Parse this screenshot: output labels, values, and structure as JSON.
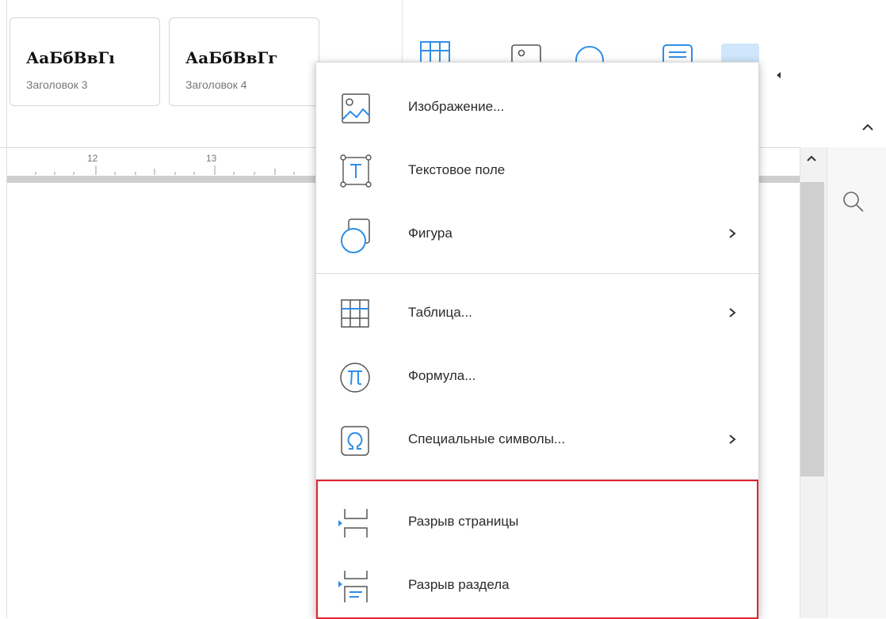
{
  "toolbar": {
    "styles": [
      {
        "preview": "АаБбВвГı",
        "name": "Заголовок 3"
      },
      {
        "preview": "АаБбВвГг",
        "name": "Заголовок 4"
      }
    ]
  },
  "ruler": {
    "ticks": [
      "12",
      "13"
    ]
  },
  "menu": {
    "items": [
      {
        "label": "Изображение...",
        "icon": "image-icon",
        "submenu": false
      },
      {
        "label": "Текстовое поле",
        "icon": "text-box-icon",
        "submenu": false
      },
      {
        "label": "Фигура",
        "icon": "shape-icon",
        "submenu": true
      },
      {
        "label": "Таблица...",
        "icon": "table-icon",
        "submenu": true
      },
      {
        "label": "Формула...",
        "icon": "formula-icon",
        "submenu": false
      },
      {
        "label": "Специальные символы...",
        "icon": "omega-icon",
        "submenu": true
      },
      {
        "label": "Разрыв страницы",
        "icon": "page-break-icon",
        "submenu": false
      },
      {
        "label": "Разрыв раздела",
        "icon": "section-break-icon",
        "submenu": false
      }
    ]
  },
  "colors": {
    "accent": "#2f8ee6",
    "highlight": "#e0242f"
  }
}
